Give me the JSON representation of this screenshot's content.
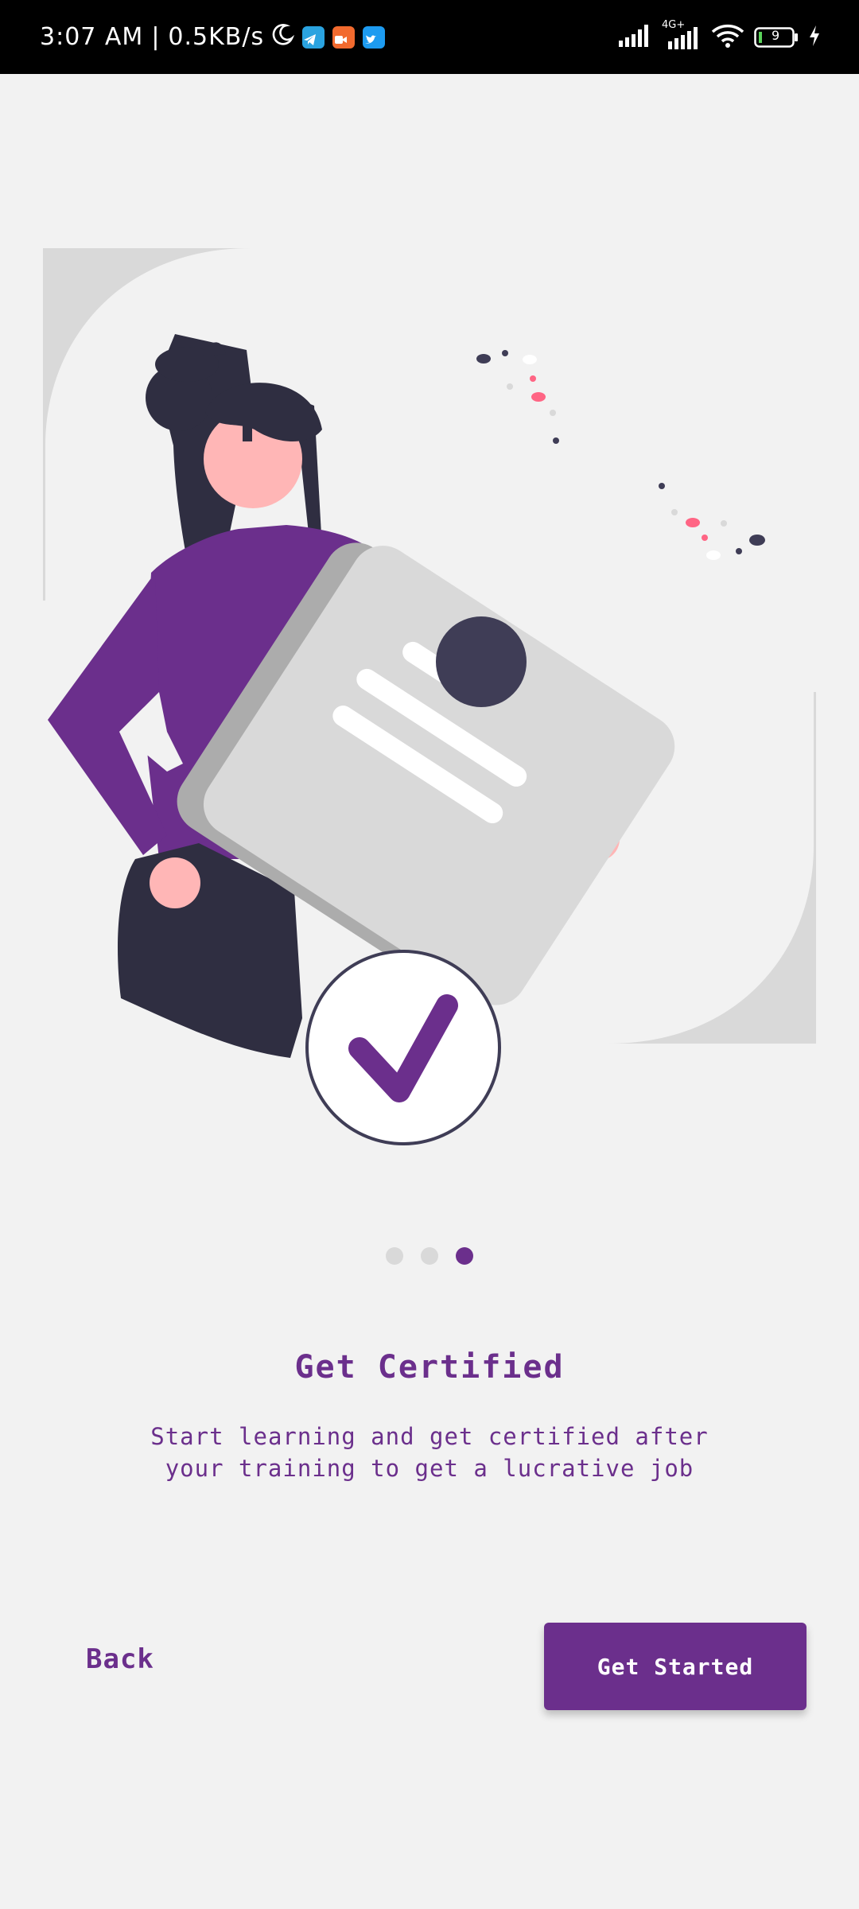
{
  "status_bar": {
    "time": "3:07 AM",
    "speed": "0.5KB/s",
    "network_type": "4G+",
    "battery_level": "9",
    "icons": [
      "moon-icon",
      "telegram-icon",
      "video-app-icon",
      "twitter-icon",
      "signal-icon",
      "signal-4g-icon",
      "wifi-icon",
      "battery-icon",
      "charging-icon"
    ]
  },
  "onboarding": {
    "illustration": "woman-holding-certificate-illustration",
    "pager": {
      "total": 3,
      "current": 3
    },
    "title": "Get Certified",
    "description": "Start learning and get certified after your training to get a lucrative job"
  },
  "actions": {
    "back_label": "Back",
    "get_started_label": "Get Started"
  },
  "colors": {
    "primary": "#6b2f8c",
    "background": "#f2f2f2",
    "dark": "#3f3d56",
    "accent_pink": "#ff6584",
    "inactive_dot": "#d9d9d9"
  }
}
